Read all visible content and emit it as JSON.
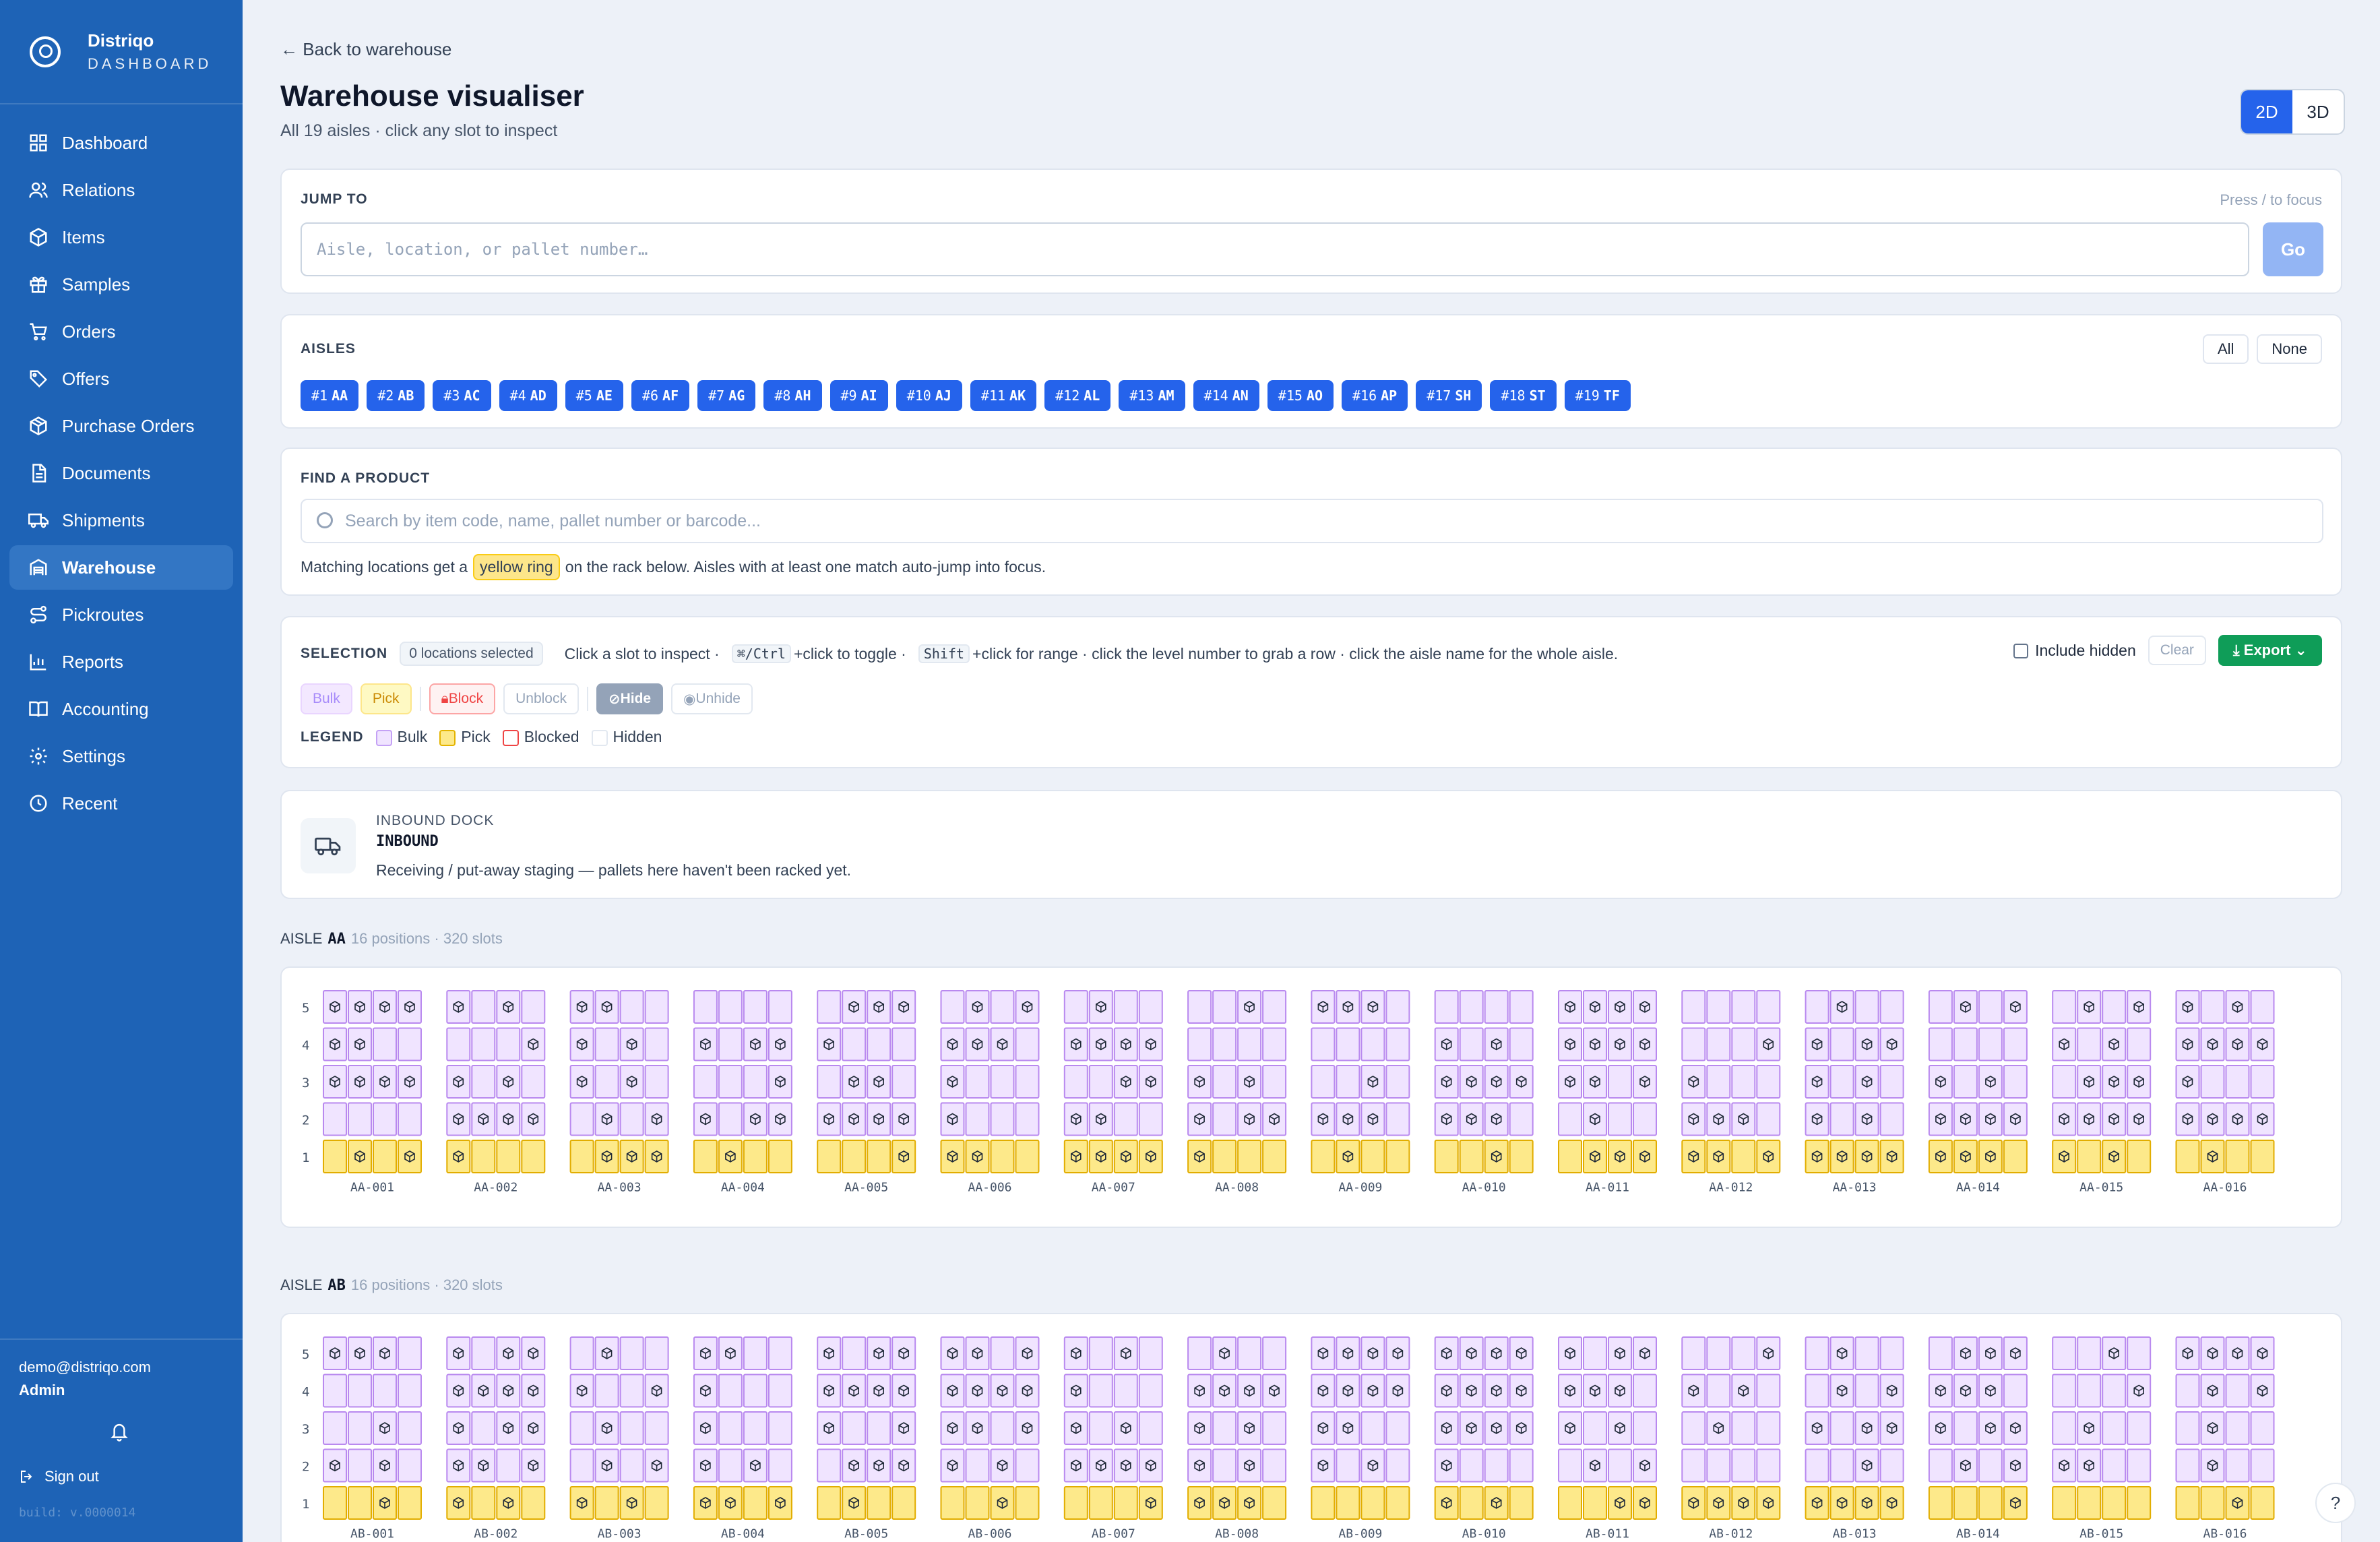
{
  "brand": {
    "name": "Distriqo",
    "sub": "DASHBOARD"
  },
  "nav": [
    {
      "label": "Dashboard",
      "icon": "grid-icon"
    },
    {
      "label": "Relations",
      "icon": "users-icon"
    },
    {
      "label": "Items",
      "icon": "box-icon"
    },
    {
      "label": "Samples",
      "icon": "gift-icon"
    },
    {
      "label": "Orders",
      "icon": "cart-icon"
    },
    {
      "label": "Offers",
      "icon": "tag-icon"
    },
    {
      "label": "Purchase Orders",
      "icon": "package-icon"
    },
    {
      "label": "Documents",
      "icon": "document-icon"
    },
    {
      "label": "Shipments",
      "icon": "truck-icon"
    },
    {
      "label": "Warehouse",
      "icon": "warehouse-icon",
      "active": true
    },
    {
      "label": "Pickroutes",
      "icon": "route-icon"
    },
    {
      "label": "Reports",
      "icon": "chart-icon"
    },
    {
      "label": "Accounting",
      "icon": "book-icon"
    },
    {
      "label": "Settings",
      "icon": "gear-icon"
    },
    {
      "label": "Recent",
      "icon": "clock-icon"
    }
  ],
  "user": {
    "email": "demo@distriqo.com",
    "role": "Admin",
    "signout": "Sign out",
    "build": "build: v.0000014"
  },
  "header": {
    "back": "Back to warehouse",
    "title": "Warehouse visualiser",
    "subtitle": "All 19 aisles · click any slot to inspect",
    "view_2d": "2D",
    "view_3d": "3D"
  },
  "jump": {
    "label": "JUMP TO",
    "hint": "Press / to focus",
    "placeholder": "Aisle, location, or pallet number…",
    "go": "Go"
  },
  "aisles_filter": {
    "label": "AISLES",
    "all": "All",
    "none": "None",
    "chips": [
      {
        "num": "#1",
        "code": "AA"
      },
      {
        "num": "#2",
        "code": "AB"
      },
      {
        "num": "#3",
        "code": "AC"
      },
      {
        "num": "#4",
        "code": "AD"
      },
      {
        "num": "#5",
        "code": "AE"
      },
      {
        "num": "#6",
        "code": "AF"
      },
      {
        "num": "#7",
        "code": "AG"
      },
      {
        "num": "#8",
        "code": "AH"
      },
      {
        "num": "#9",
        "code": "AI"
      },
      {
        "num": "#10",
        "code": "AJ"
      },
      {
        "num": "#11",
        "code": "AK"
      },
      {
        "num": "#12",
        "code": "AL"
      },
      {
        "num": "#13",
        "code": "AM"
      },
      {
        "num": "#14",
        "code": "AN"
      },
      {
        "num": "#15",
        "code": "AO"
      },
      {
        "num": "#16",
        "code": "AP"
      },
      {
        "num": "#17",
        "code": "SH"
      },
      {
        "num": "#18",
        "code": "ST"
      },
      {
        "num": "#19",
        "code": "TF"
      }
    ]
  },
  "find": {
    "label": "FIND A PRODUCT",
    "placeholder": "Search by item code, name, pallet number or barcode...",
    "note_before": "Matching locations get a",
    "note_ring": "yellow ring",
    "note_after": "on the rack below. Aisles with at least one match auto-jump into focus."
  },
  "selection": {
    "label": "SELECTION",
    "count": "0 locations selected",
    "help_1": "Click a slot to inspect ·",
    "kbd_1": "⌘/Ctrl",
    "help_2": "+click to toggle ·",
    "kbd_2": "Shift",
    "help_3": "+click for range · click the level number to grab a row · click the aisle name for the whole aisle.",
    "include_hidden": "Include hidden",
    "clear": "Clear",
    "export": "Export ⌄",
    "actions": {
      "bulk": "Bulk",
      "pick": "Pick",
      "block": "Block",
      "unblock": "Unblock",
      "hide": "Hide",
      "unhide": "Unhide"
    },
    "legend_label": "LEGEND",
    "legend": {
      "bulk": "Bulk",
      "pick": "Pick",
      "blocked": "Blocked",
      "hidden": "Hidden"
    }
  },
  "dock": {
    "label": "INBOUND DOCK",
    "code": "INBOUND",
    "desc": "Receiving / put-away staging — pallets here haven't been racked yet."
  },
  "aisle_sections": [
    {
      "prefix": "AISLE",
      "code": "AA",
      "meta": "16 positions · 320 slots",
      "levels": [
        "5",
        "4",
        "3",
        "2",
        "1"
      ],
      "positions": [
        "AA-001",
        "AA-002",
        "AA-003",
        "AA-004",
        "AA-005",
        "AA-006",
        "AA-007",
        "AA-008",
        "AA-009",
        "AA-010",
        "AA-011",
        "AA-012",
        "AA-013",
        "AA-014",
        "AA-015",
        "AA-016"
      ],
      "occupancy": [
        [
          "1111",
          "1010",
          "1100",
          "0000",
          "0111",
          "0101",
          "0100",
          "0010",
          "1110",
          "0000",
          "1111",
          "0000",
          "0100",
          "0101",
          "0101",
          "1010"
        ],
        [
          "1100",
          "0001",
          "1010",
          "1011",
          "1000",
          "1110",
          "1111",
          "0000",
          "0000",
          "1010",
          "1111",
          "0001",
          "1011",
          "0000",
          "1010",
          "1111"
        ],
        [
          "1111",
          "1010",
          "1010",
          "0001",
          "0110",
          "1000",
          "0011",
          "1010",
          "0010",
          "1111",
          "1101",
          "1000",
          "1010",
          "1010",
          "0111",
          "1000"
        ],
        [
          "0000",
          "1111",
          "0101",
          "1011",
          "1111",
          "1000",
          "1100",
          "1011",
          "1110",
          "1110",
          "0100",
          "1110",
          "1010",
          "1111",
          "1111",
          "1111"
        ],
        [
          "0101",
          "1000",
          "0111",
          "0100",
          "0001",
          "1100",
          "1111",
          "1000",
          "0100",
          "0010",
          "0111",
          "1101",
          "1111",
          "1110",
          "1010",
          "0100"
        ]
      ]
    },
    {
      "prefix": "AISLE",
      "code": "AB",
      "meta": "16 positions · 320 slots",
      "levels": [
        "5",
        "4",
        "3",
        "2",
        "1"
      ],
      "positions": [
        "AB-001",
        "AB-002",
        "AB-003",
        "AB-004",
        "AB-005",
        "AB-006",
        "AB-007",
        "AB-008",
        "AB-009",
        "AB-010",
        "AB-011",
        "AB-012",
        "AB-013",
        "AB-014",
        "AB-015",
        "AB-016"
      ],
      "occupancy": [
        [
          "1110",
          "1011",
          "0100",
          "1100",
          "1011",
          "1101",
          "1010",
          "0100",
          "1111",
          "1111",
          "1011",
          "0001",
          "0100",
          "0111",
          "0010",
          "1111"
        ],
        [
          "0000",
          "1111",
          "1001",
          "1000",
          "1111",
          "1111",
          "1000",
          "1111",
          "1111",
          "1111",
          "1110",
          "1010",
          "0101",
          "1110",
          "0001",
          "0101"
        ],
        [
          "0010",
          "1011",
          "0100",
          "1000",
          "1001",
          "1101",
          "1010",
          "1010",
          "1100",
          "1111",
          "1010",
          "0100",
          "1011",
          "1011",
          "0100",
          "0100"
        ],
        [
          "1010",
          "1101",
          "0101",
          "1010",
          "0111",
          "1010",
          "1111",
          "1010",
          "1010",
          "1000",
          "0101",
          "0000",
          "0010",
          "0101",
          "1100",
          "0100"
        ],
        [
          "0010",
          "1010",
          "1010",
          "1101",
          "0100",
          "0010",
          "0001",
          "1110",
          "0000",
          "1010",
          "0011",
          "1111",
          "1111",
          "0001",
          "0000",
          "0010"
        ]
      ]
    }
  ],
  "colors": {
    "accent": "#2563eb",
    "sidebar": "#1e63b6",
    "bulk_fill": "#f0e4ff",
    "bulk_stroke": "#b989ef",
    "pick_fill": "#fde98a",
    "pick_stroke": "#e2ad00",
    "export": "#0f9d58"
  },
  "help": "?"
}
